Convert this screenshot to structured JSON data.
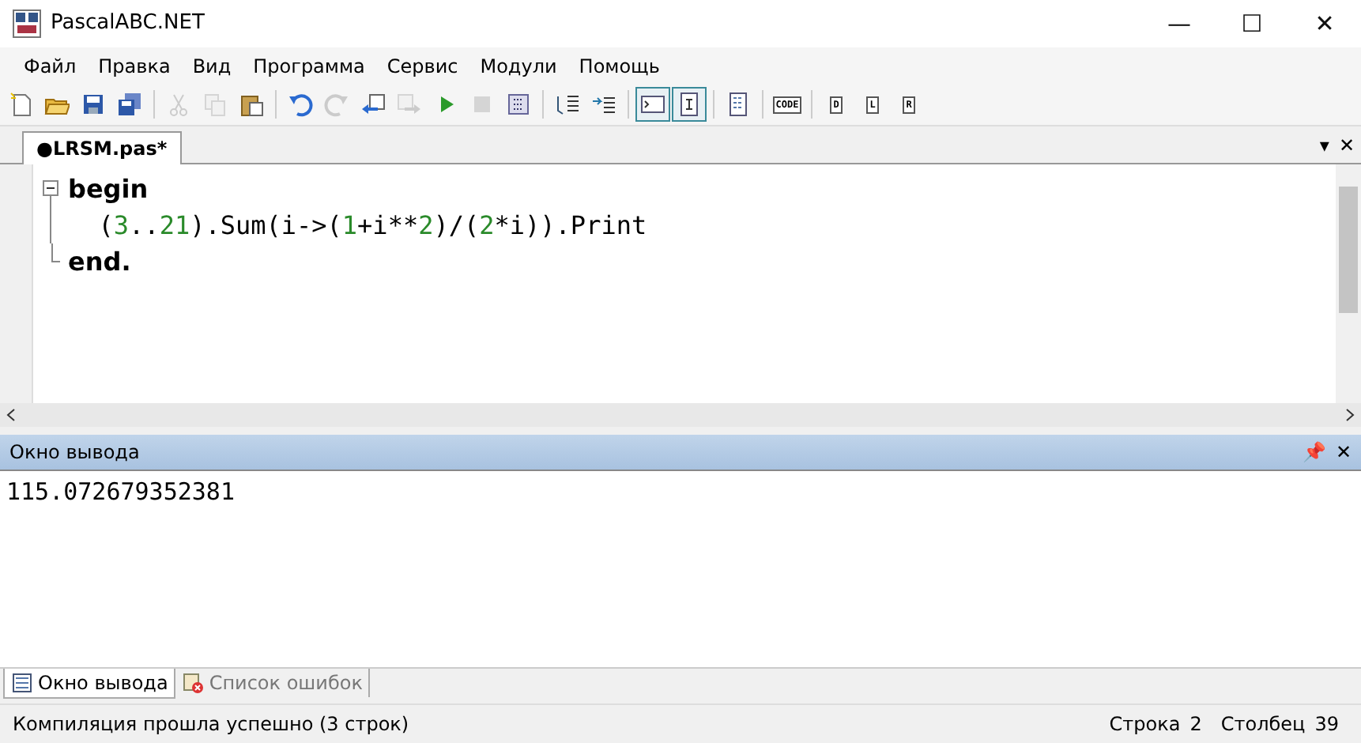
{
  "window": {
    "title": "PascalABC.NET",
    "controls": [
      "—",
      "☐",
      "✕"
    ]
  },
  "menu": [
    "Файл",
    "Правка",
    "Вид",
    "Программа",
    "Сервис",
    "Модули",
    "Помощь"
  ],
  "toolbar": [
    [
      {
        "disabled": false,
        "selected": false
      },
      {
        "disabled": false,
        "selected": false
      },
      {
        "disabled": false,
        "selected": false
      },
      {
        "disabled": false,
        "selected": false
      }
    ],
    [
      {
        "disabled": true,
        "selected": false
      },
      {
        "disabled": true,
        "selected": false
      },
      {
        "disabled": false,
        "selected": false
      }
    ],
    [
      {
        "disabled": false,
        "selected": false
      },
      {
        "disabled": true,
        "selected": false
      },
      {
        "disabled": false,
        "selected": false
      },
      {
        "disabled": true,
        "selected": false
      },
      {
        "disabled": false,
        "selected": false
      },
      {
        "disabled": true,
        "selected": false
      },
      {
        "disabled": false,
        "selected": false
      }
    ],
    [
      {
        "disabled": false,
        "selected": false
      },
      {
        "disabled": false,
        "selected": false
      }
    ],
    [
      {
        "disabled": false,
        "selected": true
      },
      {
        "disabled": false,
        "selected": true
      }
    ],
    [
      {
        "disabled": false,
        "selected": false
      }
    ],
    [
      {
        "disabled": false,
        "selected": false,
        "label": "CODE"
      }
    ],
    [
      {
        "disabled": false,
        "selected": false,
        "label": "D"
      },
      {
        "disabled": false,
        "selected": false,
        "label": "L"
      },
      {
        "disabled": false,
        "selected": false,
        "label": "R"
      }
    ]
  ],
  "editor_tabs": [
    {
      "label": "●LRSM.pas*",
      "selected": true
    }
  ],
  "editor_tab_controls": [
    "▾",
    "✕"
  ],
  "code": [
    {
      "kind": "open",
      "tokens": [
        {
          "kind": "keyword",
          "text": "begin"
        }
      ]
    },
    {
      "kind": "line",
      "tokens": [
        {
          "kind": "plain",
          "text": "  ("
        },
        {
          "kind": "number",
          "text": "3"
        },
        {
          "kind": "plain",
          "text": ".."
        },
        {
          "kind": "number",
          "text": "21"
        },
        {
          "kind": "plain",
          "text": ").Sum(i->("
        },
        {
          "kind": "number",
          "text": "1"
        },
        {
          "kind": "plain",
          "text": "+i**"
        },
        {
          "kind": "number",
          "text": "2"
        },
        {
          "kind": "plain",
          "text": ")/("
        },
        {
          "kind": "number",
          "text": "2"
        },
        {
          "kind": "plain",
          "text": "*i)).Print"
        }
      ]
    },
    {
      "kind": "end",
      "tokens": [
        {
          "kind": "keyword",
          "text": "end."
        }
      ]
    }
  ],
  "output_panel": {
    "title": "Окно вывода",
    "controls": [
      "📌",
      "✕"
    ],
    "text": "115.072679352381"
  },
  "bottom_tabs": [
    {
      "label": "Окно вывода",
      "selected": true
    },
    {
      "label": "Список ошибок",
      "selected": false
    }
  ],
  "status_bar": {
    "message": "Компиляция прошла успешно (3 строк)",
    "line_label": "Строка",
    "line": "2",
    "column_label": "Столбец",
    "column": "39"
  }
}
